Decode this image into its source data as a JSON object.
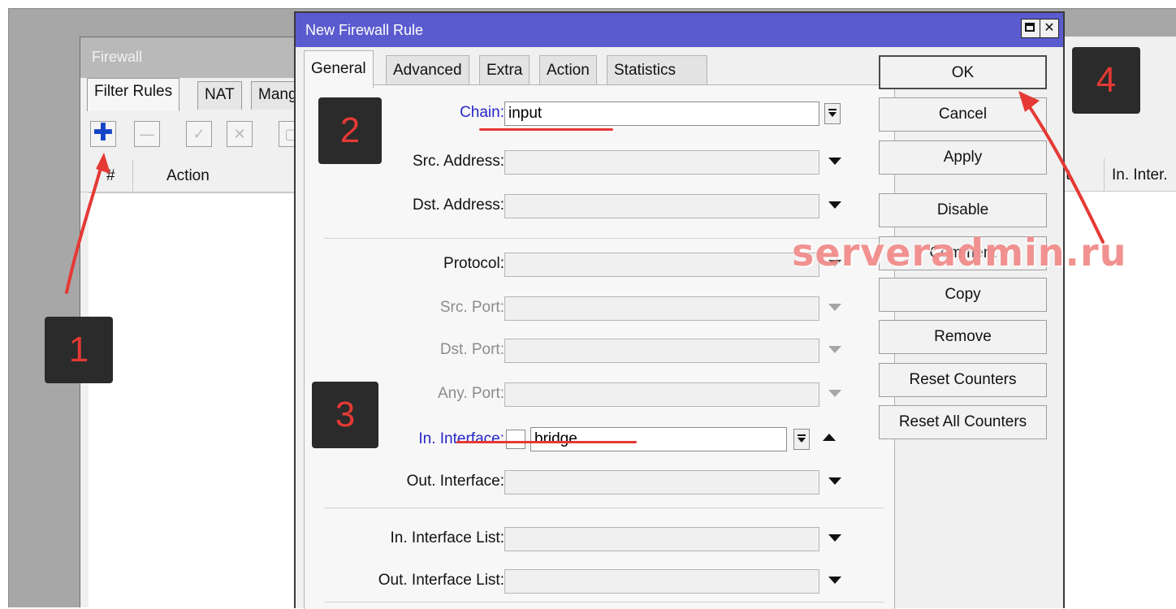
{
  "firewall_window": {
    "title": "Firewall",
    "tabs": [
      "Filter Rules",
      "NAT",
      "Mang"
    ],
    "columns": {
      "hash": "#",
      "action": "Action",
      "in_iface_tail": "In. Inter.",
      "partial_col": "ıt"
    }
  },
  "dialog": {
    "title": "New Firewall Rule",
    "tabs": [
      "General",
      "Advanced",
      "Extra",
      "Action",
      "Statistics"
    ],
    "fields": {
      "chain": {
        "label": "Chain:",
        "value": "input"
      },
      "src_address": {
        "label": "Src. Address:",
        "value": ""
      },
      "dst_address": {
        "label": "Dst. Address:",
        "value": ""
      },
      "protocol": {
        "label": "Protocol:",
        "value": ""
      },
      "src_port": {
        "label": "Src. Port:",
        "value": ""
      },
      "dst_port": {
        "label": "Dst. Port:",
        "value": ""
      },
      "any_port": {
        "label": "Any. Port:",
        "value": ""
      },
      "in_interface": {
        "label": "In. Interface:",
        "value": "bridge"
      },
      "out_interface": {
        "label": "Out. Interface:",
        "value": ""
      },
      "in_interface_list": {
        "label": "In. Interface List:",
        "value": ""
      },
      "out_interface_list": {
        "label": "Out. Interface List:",
        "value": ""
      }
    },
    "buttons": {
      "ok": "OK",
      "cancel": "Cancel",
      "apply": "Apply",
      "disable": "Disable",
      "comment": "Comment",
      "copy": "Copy",
      "remove": "Remove",
      "reset_counters": "Reset Counters",
      "reset_all_counters": "Reset All Counters"
    }
  },
  "annotations": {
    "step1": "1",
    "step2": "2",
    "step3": "3",
    "step4": "4",
    "watermark": "serveradmin.ru",
    "marker_color": "#e53935",
    "label_highlight_color": "#2626c8"
  }
}
